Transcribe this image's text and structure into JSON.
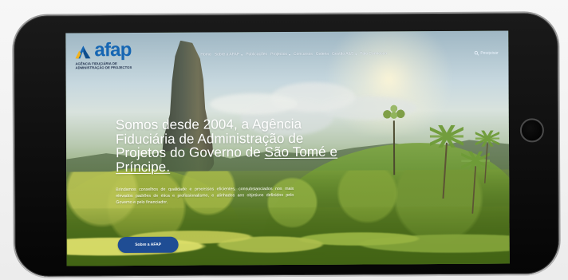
{
  "brand": {
    "name": "afap",
    "subtitle_line1": "AGÊNCIA FIDUCIÁRIA DE",
    "subtitle_line2": "ADMINISTRAÇÃO DE PROJECTOS",
    "color": "#1666b3"
  },
  "navigation": {
    "items": [
      {
        "label": "Home"
      },
      {
        "label": "Sobre a AFAP"
      },
      {
        "label": "Publicações"
      },
      {
        "label": "Projectos"
      },
      {
        "label": "Concursos"
      },
      {
        "label": "Galeria"
      },
      {
        "label": "Gestão A&S"
      },
      {
        "label": "Fale Connosco"
      }
    ],
    "search_label": "Pesquisar"
  },
  "hero": {
    "title_part1": "Somos desde 2004, a Agência",
    "title_part2": "Fiduciária de Administração de",
    "title_part3": "Projetos do Governo de ",
    "title_link1": "São Tomé e",
    "title_link2": "Príncipe.",
    "body": "Brindamos  conselhos  de  qualidade  e  processos  eficientes, consubstanciados  nos  mais  elevados  padrões  de  ética  e profissionalismo, e alinhados aos objetivos definidos pelo Governo e pelo financiador.",
    "button_label": "Sobre a AFAP"
  },
  "icons": {
    "home_button": "home-button",
    "search": "search-icon",
    "chevron": "chevron-down-icon"
  }
}
